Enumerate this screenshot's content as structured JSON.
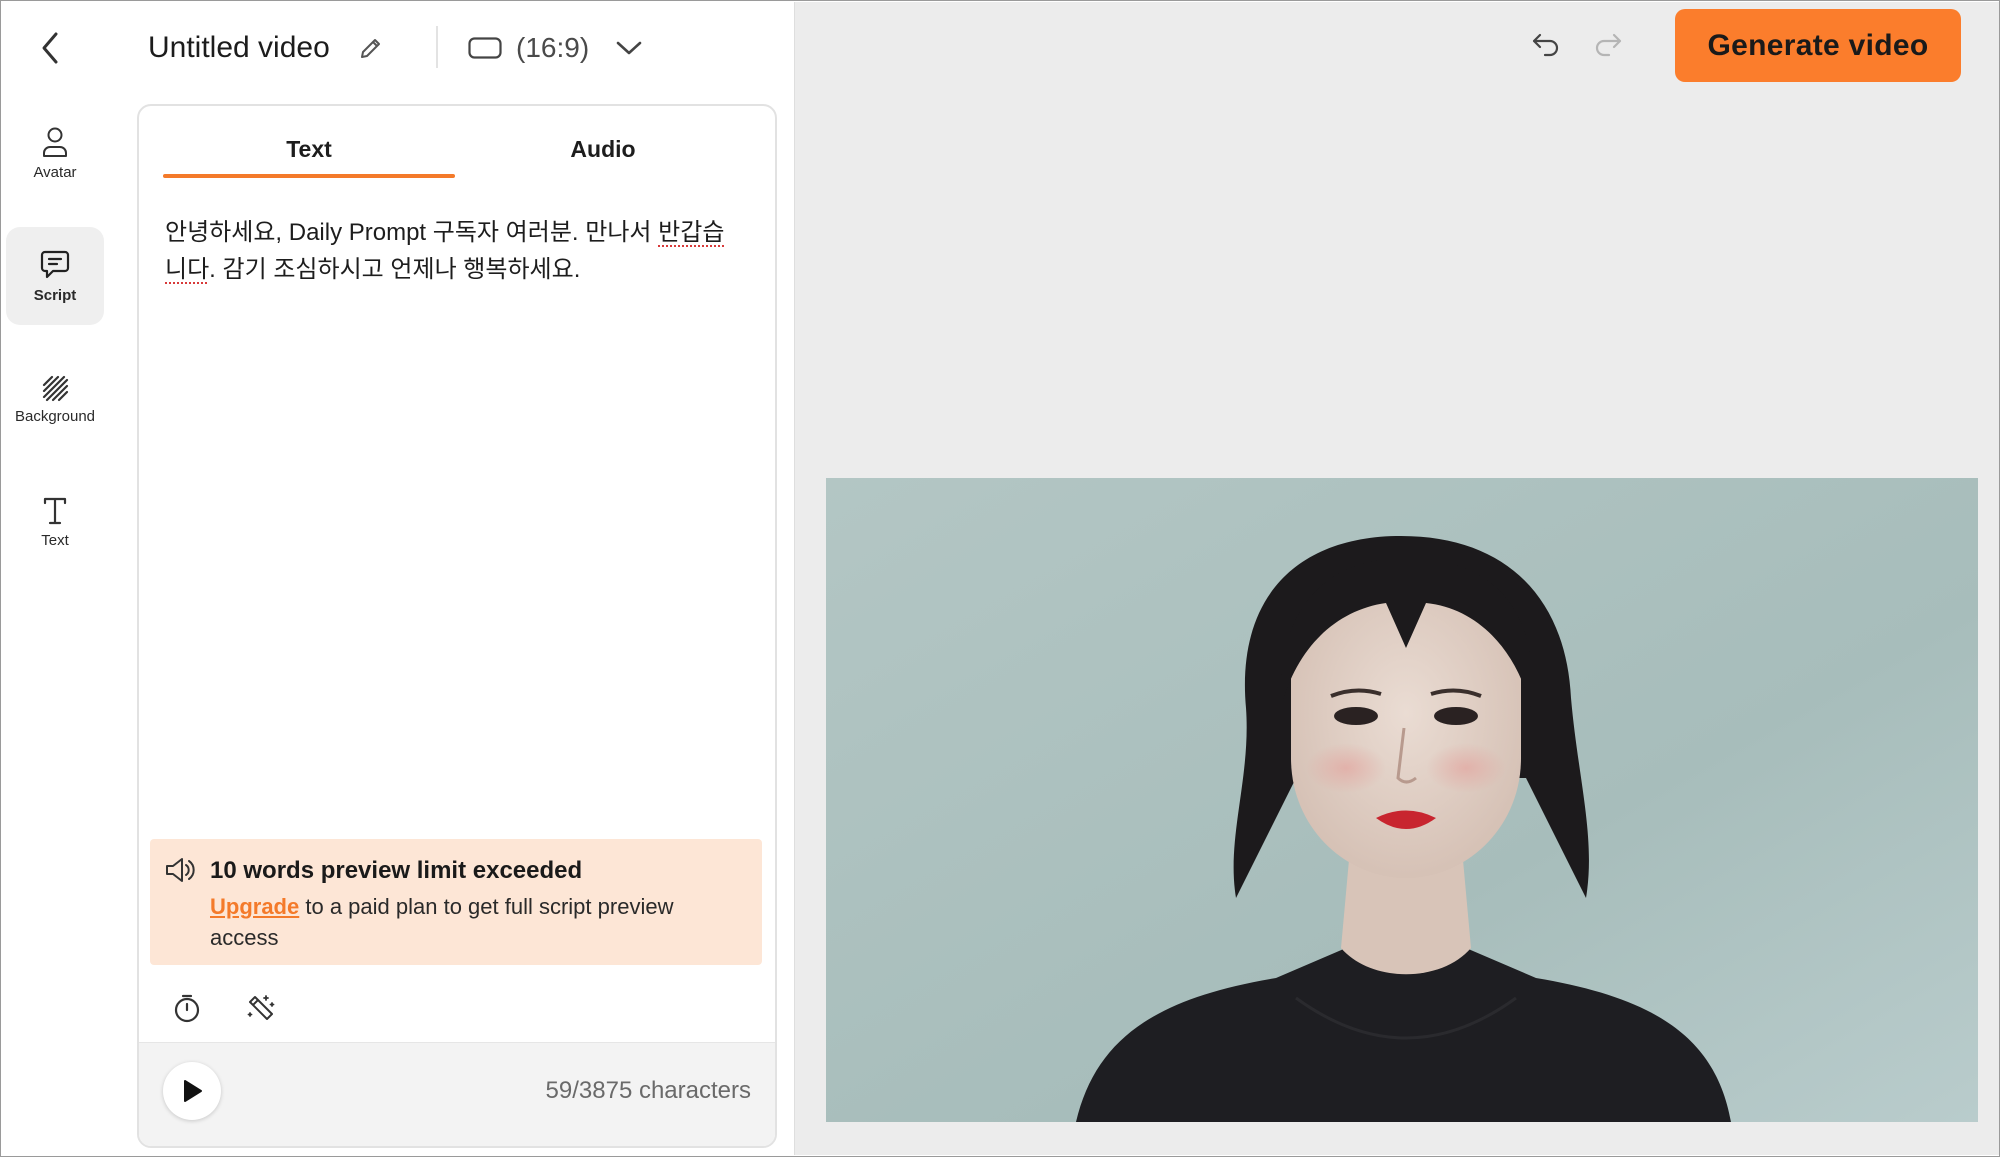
{
  "header": {
    "title": "Untitled video",
    "aspect_ratio": "(16:9)"
  },
  "nav": {
    "items": [
      {
        "label": "Avatar",
        "icon": "person-icon"
      },
      {
        "label": "Script",
        "icon": "chat-icon",
        "active": true
      },
      {
        "label": "Background",
        "icon": "hatch-icon"
      },
      {
        "label": "Text",
        "icon": "text-icon"
      }
    ]
  },
  "panel": {
    "tabs": [
      {
        "label": "Text",
        "active": true
      },
      {
        "label": "Audio",
        "active": false
      }
    ],
    "script_line1_before": "안녕하세요, Daily Prompt 구독자 여러분. 만나서 ",
    "script_line1_underlined": "반갑습",
    "script_line2_underlined": "니다",
    "script_line2_after": ". 감기 조심하시고 언제나 행복하세요.",
    "warning": {
      "title": "10 words preview limit exceeded",
      "link": "Upgrade",
      "body": " to a paid plan to get full script preview access"
    },
    "char_count": "59/3875 characters"
  },
  "toolbar": {
    "generate_label": "Generate video"
  },
  "colors": {
    "accent": "#fb7d2c",
    "tab_underline": "#f47a2a",
    "warning_bg": "#fde6d6",
    "canvas_bg": "#ececec"
  }
}
